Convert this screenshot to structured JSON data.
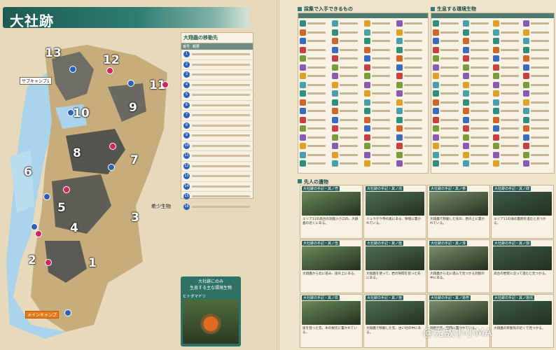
{
  "title": "大社跡",
  "map": {
    "zones": [
      "1",
      "2",
      "3",
      "4",
      "5",
      "6",
      "7",
      "8",
      "9",
      "10",
      "11",
      "12",
      "13"
    ],
    "sub_camp_label": "サブキャンプ1",
    "main_camp_label": "メインキャンプ",
    "biome_label": "希少生物"
  },
  "legend": {
    "heading": "大翔蟲の移動先",
    "col_num": "番号",
    "col_desc": "概要",
    "rows": [
      "1",
      "2",
      "3",
      "4",
      "5",
      "6",
      "7",
      "8",
      "9",
      "10",
      "11",
      "12",
      "13",
      "14",
      "15",
      "16"
    ]
  },
  "inset": {
    "title_line1": "大社跡にのみ",
    "title_line2": "生息する主な環境生物",
    "creature": "ヒトダマドリ"
  },
  "right": {
    "section1_title": "採集で入手できるもの",
    "section2_title": "生息する環境生物",
    "section3_title": "先人の遺物"
  },
  "photos": [
    {
      "cap": "大社跡の手記・其ノ壱",
      "text": "エリア11の高台の洞窟入り口の、大翔蟲の近くにある。"
    },
    {
      "cap": "大社跡の手記・其ノ弐",
      "text": "リュウグウ寺の奥にある、祭壇に置かれている。"
    },
    {
      "cap": "大社跡の手記・其ノ参",
      "text": "大翔蟲で移動した先の、岩の上に置かれている。"
    },
    {
      "cap": "大社跡の手記・其ノ肆",
      "text": "エリア11の滝の裏側を進むと見つかる。"
    },
    {
      "cap": "大社跡の手記・其ノ伍",
      "text": "大翔蟲から北に進み、崖の上にある。"
    },
    {
      "cap": "大社跡の手記・其ノ陸",
      "text": "大翔蟲を使って、岩の隙間を登った先にある。"
    },
    {
      "cap": "大社跡の手記・其ノ漆",
      "text": "大翔蟲から北に進んで見つかる洞窟の中にある。"
    },
    {
      "cap": "大社跡の手記・其ノ捌",
      "text": "高台の岩壁に沿って進むと見つかる。"
    },
    {
      "cap": "大社跡の手記・其ノ玖",
      "text": "崖を登った先、木の根元に置かれている。"
    },
    {
      "cap": "大社跡の手記・其ノ拾",
      "text": "大翔蟲で移動した先、古い社の中にある。"
    },
    {
      "cap": "大社跡の手記・其ノ拾壱",
      "text": "洞窟の奥、壁際に置かれている。"
    },
    {
      "cap": "大社跡の手記・其ノ拾弐",
      "text": "大翔蟲の移動先の近くで見つかる。"
    }
  ],
  "watermark": "@无敌小小MA",
  "colors": {
    "accent": "#2f7d73",
    "map_water": "#a8d3ea",
    "map_land": "#c8ad7c"
  }
}
